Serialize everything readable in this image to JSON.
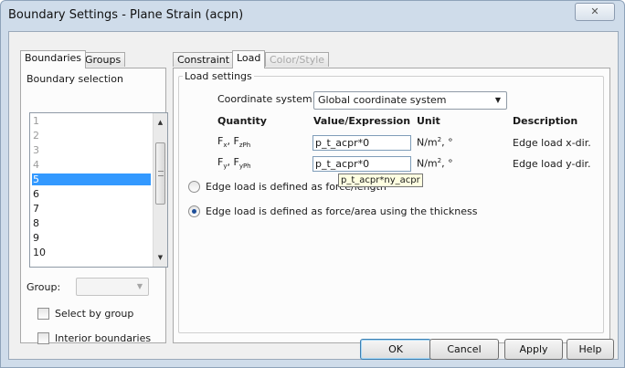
{
  "window": {
    "title": "Boundary Settings - Plane Strain (acpn)",
    "close_symbol": "✕"
  },
  "left_tabs": [
    "Boundaries",
    "Groups"
  ],
  "boundary_selection": {
    "title": "Boundary selection",
    "items": [
      "1",
      "2",
      "3",
      "4",
      "5",
      "6",
      "7",
      "8",
      "9",
      "10"
    ],
    "selected": "5",
    "group_label": "Group:",
    "group_value": "",
    "select_by_group": "Select by group",
    "interior_boundaries": "Interior boundaries"
  },
  "right_tabs": [
    "Constraint",
    "Load",
    "Color/Style"
  ],
  "load_settings": {
    "title": "Load settings",
    "coord_label": "Coordinate system:",
    "coord_value": "Global coordinate system",
    "headers": {
      "quantity": "Quantity",
      "value": "Value/Expression",
      "unit": "Unit",
      "description": "Description"
    },
    "rows": [
      {
        "quantity": "F",
        "sub1": "x",
        "sep": ", F",
        "sub2": "zPh",
        "value": "p_t_acpr*0",
        "unit": "N/m",
        "unit_sup": "2",
        "unit_suffix": ", °",
        "description": "Edge load x-dir."
      },
      {
        "quantity": "F",
        "sub1": "y",
        "sep": ", F",
        "sub2": "yPh",
        "value": "p_t_acpr*0",
        "unit": "N/m",
        "unit_sup": "2",
        "unit_suffix": ", °",
        "description": "Edge load y-dir."
      }
    ],
    "tooltip": "p_t_acpr*ny_acpr",
    "radio_force_length": "Edge load is defined as force/length",
    "radio_force_area": "Edge load is defined as force/area using the thickness"
  },
  "buttons": {
    "ok": "OK",
    "cancel": "Cancel",
    "apply": "Apply",
    "help": "Help"
  },
  "colors": {
    "selection": "#3399ff",
    "frame": "#cfdcea"
  }
}
